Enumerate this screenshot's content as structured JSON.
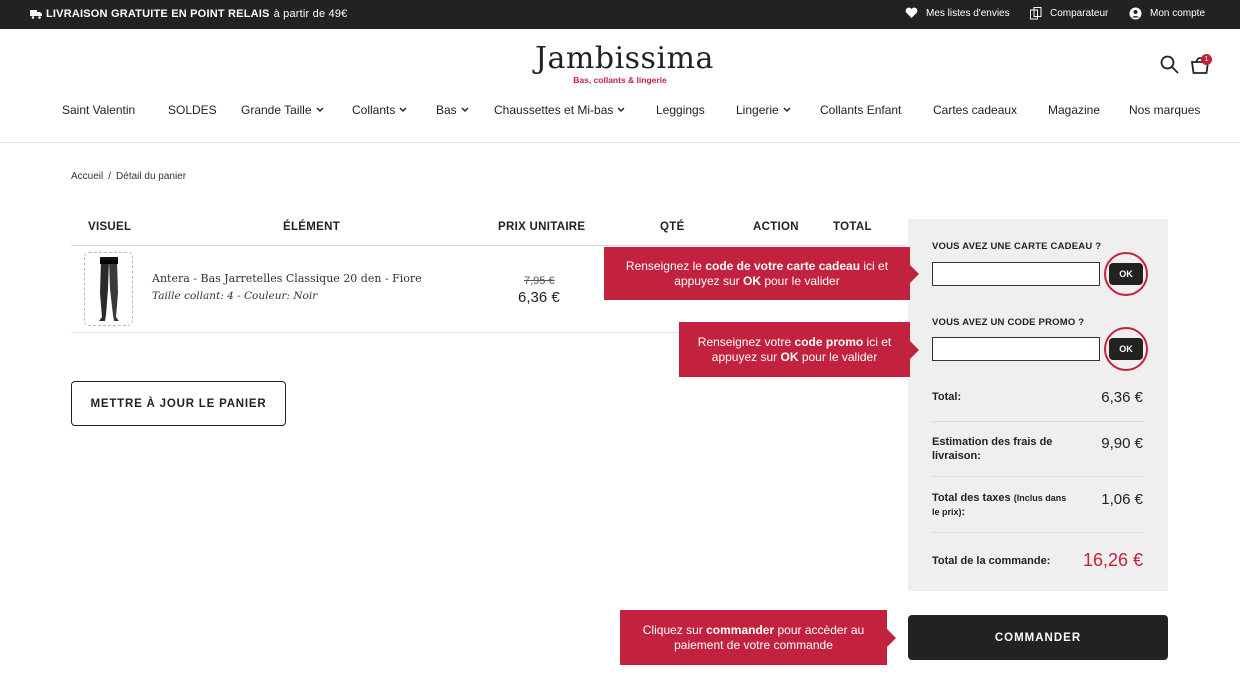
{
  "topbar": {
    "promo_bold": "LIVRAISON GRATUITE EN POINT RELAIS",
    "promo_rest": "à partir de 49€",
    "links": [
      "Mes listes d'envies",
      "Comparateur",
      "Mon compte"
    ]
  },
  "header": {
    "logo_name": "Jambissima",
    "logo_tagline": "Bas, collants & lingerie",
    "cart_count": "1"
  },
  "nav": [
    "Saint Valentin",
    "SOLDES",
    "Grande Taille",
    "Collants",
    "Bas",
    "Chaussettes et Mi-bas",
    "Leggings",
    "Lingerie",
    "Collants Enfant",
    "Cartes cadeaux",
    "Magazine",
    "Nos marques"
  ],
  "breadcrumb": {
    "home": "Accueil",
    "sep": "/",
    "current": "Détail du panier"
  },
  "table": {
    "headers": [
      "VISUEL",
      "ÉLÉMENT",
      "PRIX UNITAIRE",
      "QTÉ",
      "ACTION",
      "TOTAL"
    ],
    "product": {
      "name": "Antera - Bas Jarretelles Classique 20 den - Fiore",
      "meta": "Taille collant: 4 - Couleur: Noir",
      "price_old": "7,95 €",
      "price_new": "6,36 €"
    }
  },
  "update_button": "METTRE À JOUR LE PANIER",
  "summary": {
    "gift_label": "VOUS AVEZ UNE CARTE CADEAU ?",
    "gift_value": "",
    "promo_label": "VOUS AVEZ UN CODE PROMO ?",
    "promo_value": "",
    "ok": "OK",
    "total_label": "Total:",
    "total_value": "6,36 €",
    "shipping_label": "Estimation des frais de livraison:",
    "shipping_value": "9,90 €",
    "tax_label": "Total des taxes",
    "tax_note": "(Inclus dans le prix)",
    "tax_colon": ":",
    "tax_value": "1,06 €",
    "grand_label": "Total de la commande:",
    "grand_value": "16,26 €"
  },
  "order_button": "COMMANDER",
  "callouts": {
    "gift": {
      "pre": "Renseignez le ",
      "bold": "code de votre carte cadeau",
      "mid": " ici et appuyez sur ",
      "bold2": "OK",
      "post": " pour le valider"
    },
    "promo": {
      "pre": "Renseignez votre ",
      "bold": "code promo",
      "mid": " ici et appuyez sur ",
      "bold2": "OK",
      "post": " pour le valider"
    },
    "order": {
      "pre": "Cliquez sur ",
      "bold": "commander",
      "mid": " pour accèder au paiement de votre commande"
    }
  },
  "colors": {
    "accent": "#c3223f",
    "dark": "#222222",
    "panel": "#efefef"
  }
}
